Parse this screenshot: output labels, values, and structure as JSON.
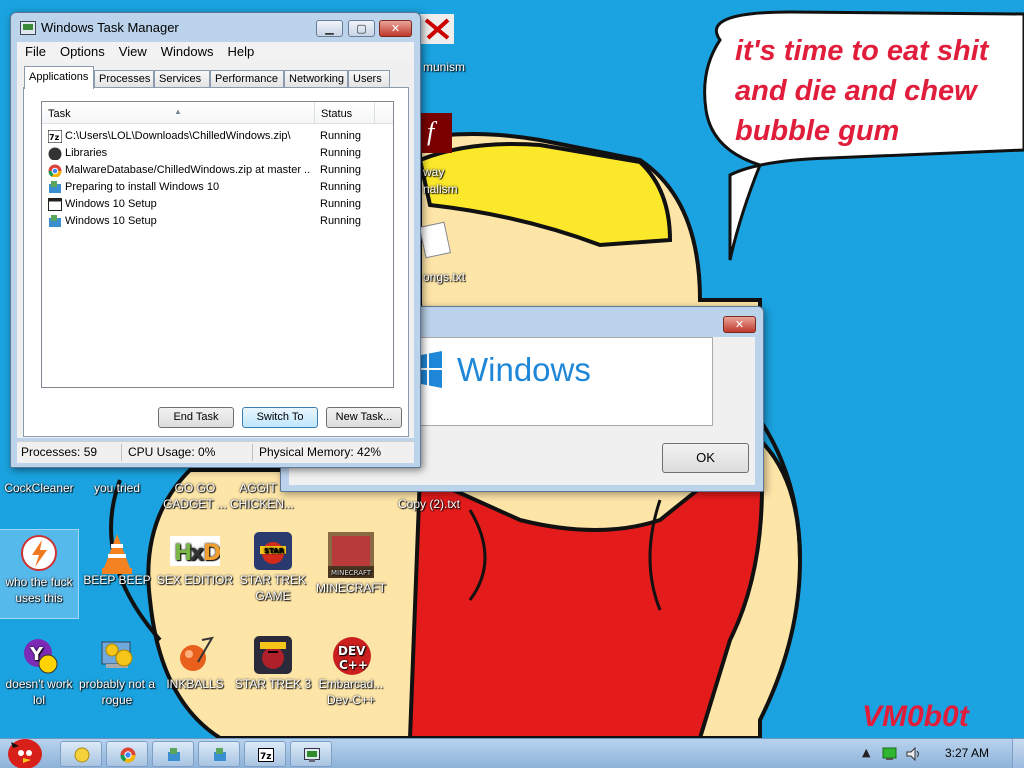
{
  "wallpaper": {
    "bubble_lines": [
      "it's time to eat shit",
      "and die and chew",
      "bubble gum"
    ],
    "signature": "VM0b0t"
  },
  "desktop_icons": [
    {
      "label": "CockCleaner",
      "icon": "cockcleaner-icon"
    },
    {
      "label": "you tried",
      "icon": "shortcut-icon"
    },
    {
      "label": "GO GO GADGET ...",
      "icon": "gadget-icon"
    },
    {
      "label": "AGGIT CHICKEN...",
      "icon": "chicken-icon"
    },
    {
      "label": "Copy (2).txt",
      "icon": "text-file-icon"
    },
    {
      "label": "who the fuck uses this",
      "icon": "thunderbolt-icon"
    },
    {
      "label": "BEEP BEEP",
      "icon": "vlc-icon"
    },
    {
      "label": "SEX EDITIOR",
      "icon": "hxd-icon"
    },
    {
      "label": "STAR TREK GAME",
      "icon": "angry-birds-star-wars-icon"
    },
    {
      "label": "MINECRAFT",
      "icon": "minecraft-icon"
    },
    {
      "label": "doesn't work lol",
      "icon": "yahoo-messenger-icon"
    },
    {
      "label": "probably not a rogue",
      "icon": "system-gear-icon"
    },
    {
      "label": "INKBALLS",
      "icon": "inkball-icon"
    },
    {
      "label": "STAR TREK 3",
      "icon": "angry-birds-star-wars-2-icon"
    },
    {
      "label": "Embarcad... Dev-C++",
      "icon": "devcpp-icon"
    }
  ],
  "partial_labels": {
    "communism": "munism",
    "way": "way",
    "journalism": "nalism",
    "songs": "ongs.txt"
  },
  "task_manager": {
    "title": "Windows Task Manager",
    "menu": [
      "File",
      "Options",
      "View",
      "Windows",
      "Help"
    ],
    "tabs": [
      "Applications",
      "Processes",
      "Services",
      "Performance",
      "Networking",
      "Users"
    ],
    "active_tab": "Applications",
    "columns": {
      "task": "Task",
      "status": "Status"
    },
    "rows": [
      {
        "task": "C:\\Users\\LOL\\Downloads\\ChilledWindows.zip\\",
        "status": "Running",
        "icon": "7zip-icon"
      },
      {
        "task": "Libraries",
        "status": "Running",
        "icon": "libraries-icon"
      },
      {
        "task": "MalwareDatabase/ChilledWindows.zip at master ...",
        "status": "Running",
        "icon": "chrome-icon"
      },
      {
        "task": "Preparing to install Windows 10",
        "status": "Running",
        "icon": "installer-icon"
      },
      {
        "task": "Windows 10 Setup",
        "status": "Running",
        "icon": "window-icon"
      },
      {
        "task": "Windows 10 Setup",
        "status": "Running",
        "icon": "installer-icon"
      }
    ],
    "buttons": {
      "end_task": "End Task",
      "switch_to": "Switch To",
      "new_task": "New Task..."
    },
    "status": {
      "processes": "Processes: 59",
      "cpu": "CPU Usage: 0%",
      "memory": "Physical Memory: 42%"
    }
  },
  "windows_dialog": {
    "brand": "Windows",
    "ok_label": "OK"
  },
  "taskbar": {
    "buttons": [
      "explorer-icon",
      "chrome-icon",
      "installer-icon",
      "installer-icon",
      "7zip-icon",
      "task-manager-icon"
    ],
    "clock": "3:27 AM"
  },
  "colors": {
    "desktop": "#1aa3e0",
    "wall_text": "#e01e3c",
    "windows_blue": "#1e87d8"
  }
}
